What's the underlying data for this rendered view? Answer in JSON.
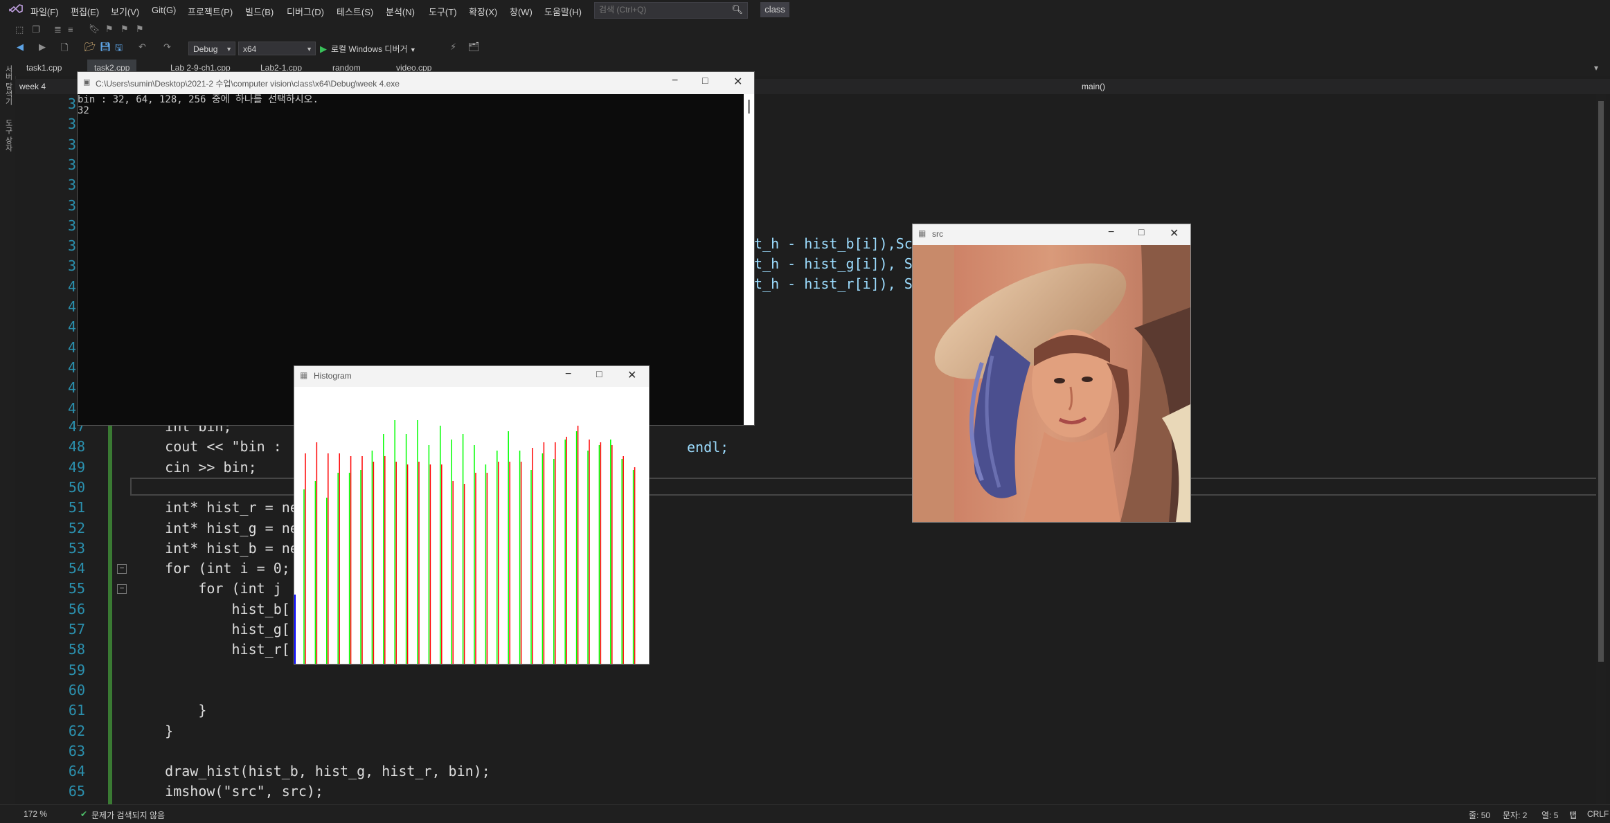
{
  "menubar": {
    "items": [
      "파일(F)",
      "편집(E)",
      "보기(V)",
      "Git(G)",
      "프로젝트(P)",
      "빌드(B)",
      "디버그(D)",
      "테스트(S)",
      "분석(N)",
      "도구(T)",
      "확장(X)",
      "창(W)",
      "도움말(H)"
    ],
    "search_placeholder": "검색 (Ctrl+Q)",
    "solution_name": "class"
  },
  "toolbar": {
    "config": "Debug",
    "platform": "x64",
    "run_label": "로컬 Windows 디버거"
  },
  "side_strip": {
    "server_explorer": "서버 탐색기",
    "toolbox": "도구 상자"
  },
  "tabs": [
    "task1.cpp",
    "task2.cpp",
    "Lab 2-9-ch1.cpp",
    "Lab2-1.cpp",
    "random",
    "video.cpp"
  ],
  "navbar": {
    "project": "week 4",
    "member": "main()"
  },
  "editor": {
    "hidden_line_numbers": [
      "3",
      "3",
      "3",
      "3",
      "3",
      "3",
      "3",
      "3",
      "3",
      "4",
      "4",
      "4",
      "4",
      "4",
      "4",
      "4"
    ],
    "lines": [
      {
        "n": "47",
        "code": "    int bin;"
      },
      {
        "n": "48",
        "code": "    cout << \"bin : "
      },
      {
        "n": "49",
        "code": "    cin >> bin;"
      },
      {
        "n": "50",
        "code": ""
      },
      {
        "n": "51",
        "code": "    int* hist_r = ne"
      },
      {
        "n": "52",
        "code": "    int* hist_g = ne"
      },
      {
        "n": "53",
        "code": "    int* hist_b = ne"
      },
      {
        "n": "54",
        "code": "    for (int i = 0;"
      },
      {
        "n": "55",
        "code": "        for (int j "
      },
      {
        "n": "56",
        "code": "            hist_b["
      },
      {
        "n": "57",
        "code": "            hist_g["
      },
      {
        "n": "58",
        "code": "            hist_r["
      },
      {
        "n": "59",
        "code": ""
      },
      {
        "n": "60",
        "code": ""
      },
      {
        "n": "61",
        "code": "        }"
      },
      {
        "n": "62",
        "code": "    }"
      },
      {
        "n": "63",
        "code": ""
      },
      {
        "n": "64",
        "code": "    draw_hist(hist_b, hist_g, hist_r, bin);"
      },
      {
        "n": "65",
        "code": "    imshow(\"src\", src);"
      }
    ],
    "fragments": {
      "line48_tail": "endl;",
      "line38": "t_h - hist_b[i]),Sc",
      "line39": "t_h - hist_g[i]), S",
      "line40": "t_h - hist_r[i]), S"
    }
  },
  "console": {
    "title": "C:\\Users\\sumin\\Desktop\\2021-2 수업\\computer vision\\class\\x64\\Debug\\week 4.exe",
    "lines": [
      "bin : 32, 64, 128, 256 중에 하나를 선택하시오.",
      "32"
    ]
  },
  "histogram_window": {
    "title": "Histogram",
    "colors": {
      "green": "#00ff00",
      "red": "#ff0000",
      "blue": "#0000ff"
    },
    "green_tops": [
      0.63,
      0.66,
      0.6,
      0.69,
      0.69,
      0.7,
      0.77,
      0.83,
      0.88,
      0.83,
      0.88,
      0.79,
      0.86,
      0.81,
      0.83,
      0.79,
      0.72,
      0.77,
      0.84,
      0.77,
      0.7,
      0.76,
      0.74,
      0.81,
      0.84,
      0.77,
      0.79,
      0.81,
      0.74,
      0.7
    ],
    "red_tops": [
      0.76,
      0.8,
      0.76,
      0.76,
      0.75,
      0.75,
      0.73,
      0.75,
      0.73,
      0.72,
      0.73,
      0.72,
      0.72,
      0.66,
      0.65,
      0.69,
      0.69,
      0.73,
      0.73,
      0.73,
      0.78,
      0.8,
      0.8,
      0.82,
      0.86,
      0.81,
      0.8,
      0.79,
      0.75,
      0.71
    ]
  },
  "src_window": {
    "title": "src"
  },
  "statusbar": {
    "zoom": "172 %",
    "issues": "문제가 검색되지 않음",
    "line": "줄: 50",
    "char": "문자: 2",
    "col": "열: 5",
    "tab": "탭",
    "eol": "CRLF"
  }
}
